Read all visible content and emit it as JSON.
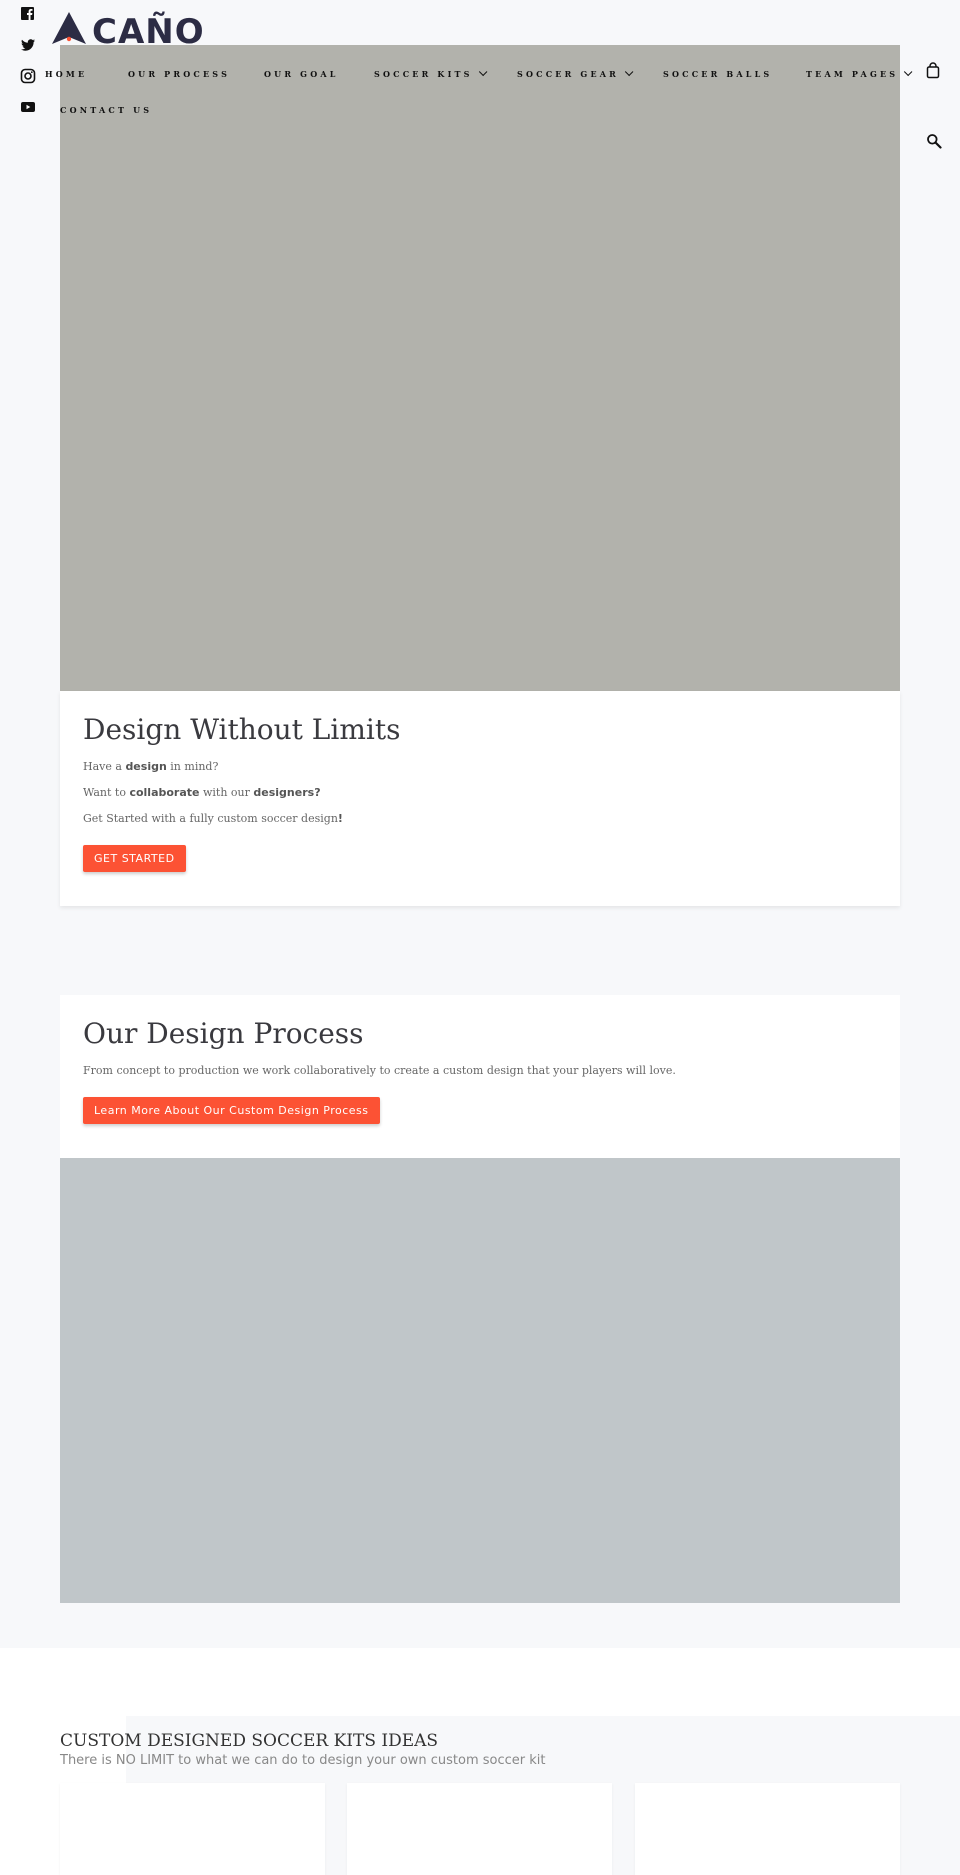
{
  "brand": {
    "name": "CAÑO",
    "accent_color": "#fc5234",
    "logo_color": "#2c2c44"
  },
  "social": [
    {
      "icon": "facebook-icon"
    },
    {
      "icon": "twitter-icon"
    },
    {
      "icon": "instagram-icon"
    },
    {
      "icon": "youtube-icon"
    }
  ],
  "nav": {
    "items": [
      {
        "label": "HOME",
        "dropdown": false
      },
      {
        "label": "OUR PROCESS",
        "dropdown": false
      },
      {
        "label": "OUR GOAL",
        "dropdown": false
      },
      {
        "label": "SOCCER KITS",
        "dropdown": true
      },
      {
        "label": "SOCCER GEAR",
        "dropdown": true
      },
      {
        "label": "SOCCER BALLS",
        "dropdown": false
      },
      {
        "label": "TEAM PAGES",
        "dropdown": true
      },
      {
        "label": "CONTACT US",
        "dropdown": false
      }
    ],
    "cart_icon": "shopping-bag-icon",
    "search_icon": "search-icon"
  },
  "hero": {
    "image_color": "#b2b2ac",
    "title": "Design Without Limits",
    "line1": {
      "pre": "Have a ",
      "bold": "design",
      "post": " in mind?"
    },
    "line2": {
      "pre": "Want to ",
      "bold1": "collaborate",
      "mid": " with our ",
      "bold2": "designers?"
    },
    "line3": {
      "pre": "Get Started with a fully custom soccer design",
      "bold": "!"
    },
    "button": "GET STARTED"
  },
  "process": {
    "title": "Our Design Process",
    "text": "From concept to production we work collaboratively to create a custom design that your players will love.",
    "button": "Learn More About Our Custom Design Process",
    "image_color": "#c0c6c9"
  },
  "kits": {
    "title": "CUSTOM DESIGNED SOCCER KITS IDEAS",
    "subtitle": "There is NO LIMIT to what we can do to design your own custom soccer kit"
  }
}
